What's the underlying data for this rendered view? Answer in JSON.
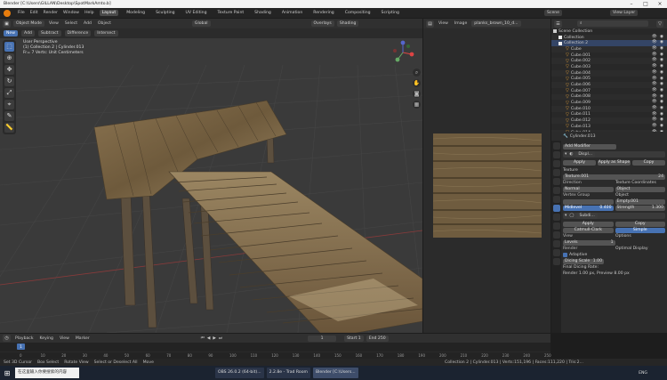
{
  "titlebar": {
    "title": "Blender [C:\\Users\\GILLAN\\Desktop\\SpotMarkAmto.b]"
  },
  "menubar": {
    "menus": [
      "File",
      "Edit",
      "Render",
      "Window",
      "Help"
    ],
    "workspaces": [
      "Layout",
      "Modeling",
      "Sculpting",
      "UV Editing",
      "Texture Paint",
      "Shading",
      "Animation",
      "Rendering",
      "Compositing",
      "Scripting"
    ],
    "active_workspace": "Layout",
    "scene_label": "Scene",
    "view_layer_label": "View Layer"
  },
  "viewport": {
    "mode": "Object Mode",
    "menus": [
      "View",
      "Select",
      "Add",
      "Object"
    ],
    "transform": "Global",
    "overlays": "Overlays",
    "shading": "Shading",
    "tools": [
      "New",
      "Add",
      "Subtract",
      "Difference",
      "Intersect"
    ],
    "info_lines": [
      "User Perspective",
      "(1) Collection 2 | Cylinder.013",
      "Fr= 7 Verts: Unit Centimeters"
    ]
  },
  "image_editor": {
    "menus": [
      "View",
      "Image"
    ],
    "image_name": "planks_brown_10_d..."
  },
  "outliner": {
    "search_placeholder": "",
    "rows": [
      {
        "label": "Scene Collection",
        "kind": "scene"
      },
      {
        "label": "Collection",
        "kind": "collection"
      },
      {
        "label": "Collection 2",
        "kind": "collection",
        "selected": true
      },
      {
        "label": "Cube",
        "kind": "mesh"
      },
      {
        "label": "Cube.001",
        "kind": "mesh"
      },
      {
        "label": "Cube.002",
        "kind": "mesh"
      },
      {
        "label": "Cube.003",
        "kind": "mesh"
      },
      {
        "label": "Cube.004",
        "kind": "mesh"
      },
      {
        "label": "Cube.005",
        "kind": "mesh"
      },
      {
        "label": "Cube.006",
        "kind": "mesh"
      },
      {
        "label": "Cube.007",
        "kind": "mesh"
      },
      {
        "label": "Cube.008",
        "kind": "mesh"
      },
      {
        "label": "Cube.009",
        "kind": "mesh"
      },
      {
        "label": "Cube.010",
        "kind": "mesh"
      },
      {
        "label": "Cube.011",
        "kind": "mesh"
      },
      {
        "label": "Cube.012",
        "kind": "mesh"
      },
      {
        "label": "Cube.013",
        "kind": "mesh"
      },
      {
        "label": "Cube.014",
        "kind": "mesh"
      }
    ]
  },
  "properties": {
    "object_name": "Cylinder.013",
    "add_modifier": "Add Modifier",
    "displace": {
      "name": "Displ...",
      "apply": "Apply",
      "apply_shape": "Apply as Shape",
      "copy": "Copy",
      "texture_label": "Texture",
      "texture_value": "Texture.001",
      "texture_users": "24",
      "direction_label": "Direction",
      "direction_value": "Normal",
      "tex_coords_label": "Texture Coordinates",
      "tex_coords_value": "Object",
      "vgroup_label": "Vertex Group",
      "object_label": "Object",
      "object_value": "Empty.001",
      "midlevel_label": "Midlevel",
      "midlevel_value": "0.400",
      "strength_label": "Strength",
      "strength_value": "1.300"
    },
    "subsurf": {
      "name": "Subdi...",
      "apply": "Apply",
      "copy": "Copy",
      "catmull": "Catmull-Clark",
      "simple": "Simple",
      "view_label": "View",
      "levels_label": "Levels",
      "levels_value": "1",
      "options_label": "Options",
      "render_label": "Render",
      "render_levels": "2",
      "optimal_display": "Optimal Display",
      "adaptive": "Adaptive",
      "dicing_label": "Dicing Scale",
      "dicing_value": "1.00",
      "final_dicing": "Final Dicing Rate:",
      "final_dicing_values": "Render 1.00 px, Preview 8.00 px"
    }
  },
  "timeline": {
    "menus": [
      "Playback",
      "Keying",
      "View",
      "Marker"
    ],
    "current_frame": "1",
    "start_label": "Start",
    "start_value": "1",
    "end_label": "End",
    "end_value": "250",
    "ticks": [
      "0",
      "10",
      "20",
      "30",
      "40",
      "50",
      "60",
      "70",
      "80",
      "90",
      "100",
      "110",
      "120",
      "130",
      "140",
      "150",
      "160",
      "170",
      "180",
      "190",
      "200",
      "210",
      "220",
      "230",
      "240",
      "250"
    ]
  },
  "statusbar": {
    "items": [
      "Set 3D Cursor",
      "Box Select",
      "Rotate View",
      "Select or Deselect All",
      "Move"
    ],
    "stats": "Collection 2 | Cylinder.013 | Verts:151,196 | Faces:111,220 | Tris:2..."
  },
  "taskbar": {
    "search_placeholder": "在这里输入你要搜索的内容",
    "tasks": [
      "OBS 26.0.2 (64-bit)...",
      "2.2.8e - Trad Room",
      "Blender [C:\\Users..."
    ],
    "clock": "ENG"
  }
}
